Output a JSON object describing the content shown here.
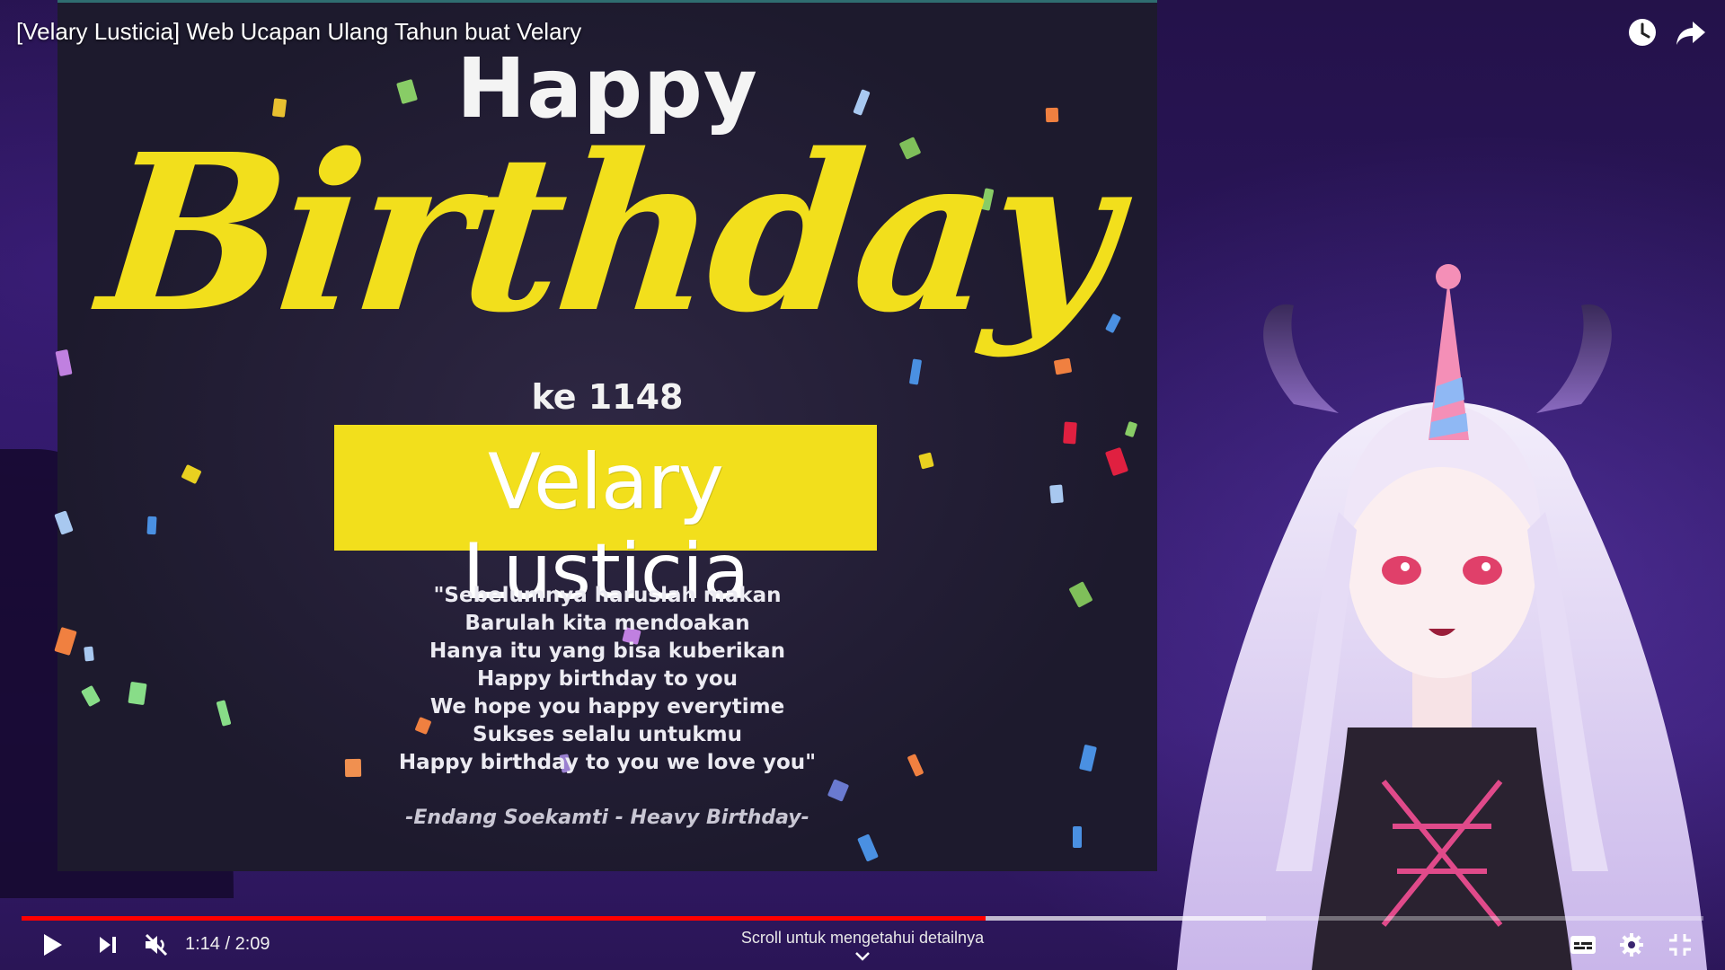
{
  "window": {
    "video_title": "[Velary Lusticia] Web Ucapan Ulang Tahun buat Velary"
  },
  "header_icons": [
    "watch-later-icon",
    "share-icon"
  ],
  "video_frame": {
    "happy": "Happy",
    "birthday": "Birthday",
    "ke": "ke 1148",
    "name": "Velary Lusticia",
    "lyrics": [
      "\"Sebelumnya haruslah makan",
      "Barulah kita mendoakan",
      "Hanya itu yang bisa kuberikan",
      "Happy birthday to you",
      "We hope you happy everytime",
      "Sukses selalu untukmu",
      "Happy birthday to you we love you\""
    ],
    "credit": "-Endang Soekamti - Heavy Birthday-",
    "colors": {
      "accent_yellow": "#f2df1c",
      "panel": "#221d34"
    }
  },
  "player": {
    "current_time": "1:14",
    "separator": " / ",
    "duration": "2:09",
    "played_fraction": 0.573,
    "buffered_fraction": 0.74,
    "scroll_hint": "Scroll untuk mengetahui detailnya",
    "controls": [
      "play-icon",
      "next-icon",
      "mute-icon",
      "subtitles-icon",
      "settings-icon",
      "exit-fullscreen-icon"
    ],
    "progress_color": "#ff0000"
  }
}
